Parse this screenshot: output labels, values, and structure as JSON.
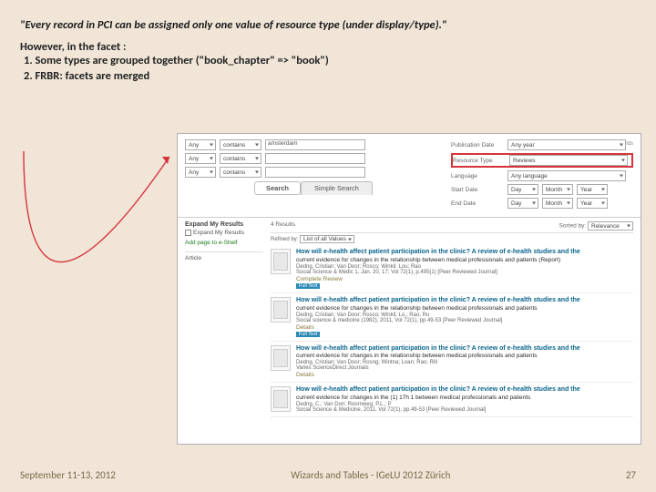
{
  "slide": {
    "quote": "\"Every record in PCI can be assigned only one value of resource type (under display/type).\"",
    "however": "However, in the facet :",
    "list": [
      "1.   Some types are grouped together (\"book_chapter\" => \"book\")",
      "2.   FRBR: facets are merged"
    ]
  },
  "screenshot": {
    "terms": [
      {
        "field": "Any",
        "op": "contains",
        "value": "amsterdam"
      },
      {
        "field": "Any",
        "op": "contains",
        "value": ""
      },
      {
        "field": "Any",
        "op": "contains",
        "value": ""
      }
    ],
    "filters": {
      "pubdate_label": "Publication Date",
      "pubdate_value": "Any year",
      "restype_label": "Resource Type",
      "restype_value": "Reviews",
      "lang_label": "Language",
      "lang_value": "Any language",
      "start_label": "Start Date",
      "end_label": "End Date",
      "day": "Day",
      "month": "Month",
      "year": "Year"
    },
    "reset": "reset all fields",
    "search_btn": "Search",
    "simple_tab": "Simple Search",
    "facet_header": "Expand My Results",
    "facet_cb": "Expand My Results",
    "add_page": "Add page to e-Shelf",
    "facet_article": "Article",
    "results_count": "4 Results",
    "refined_by": "Refined by:",
    "sorted_by": "Sorted by:",
    "sort_value": "Relevance",
    "list_of": "List of all Values",
    "items": [
      {
        "title": "How will e-health affect patient participation in the clinic? A review of e-health studies and the",
        "sub": "current evidence for changes in the relationship between medical professionals and patients (Report)",
        "authors": "Dedng, Cristian; Van Door; Rosco; Winkli; Lou; Rao",
        "src": "Social Science & Medic 1, Jan. 20, 17; Vol 72(1), p.495(1) [Peer Reviewed Journal]",
        "cat": "Complete Review",
        "badge": "Full Text"
      },
      {
        "title": "How will e-health affect patient participation in the clinic? A review of e-health studies and the",
        "sub": "current evidence for changes in the relationship between medical professionals and patients",
        "authors": "Dedng, Cristian; Van Door; Rosco; Winkli; Lo.; Rao; Ru",
        "src": "Social science & medicine (1982), 2011, Vol 72(1), pp.49-53 [Peer Reviewed Journal]",
        "cat": "Details",
        "badge": "Full Text"
      },
      {
        "title": "How will e-health affect patient participation in the clinic? A review of e-health studies and the",
        "sub": "current evidence for changes in the relationship between medical professionals and patients",
        "authors": "Dedng, Cristian; Van Door; Rosng; Wintna; Loan; Rao; Rill",
        "src": "Varies ScienceDirect Journals",
        "cat": "Details",
        "badge": ""
      },
      {
        "title": "How will e-health affect patient participation in the clinic? A review of e-health studies and the",
        "sub": "current evidence for changes in the (1) 17h 1 between medical professionals and patients",
        "authors": "Dedng, C.; Van Don; Roornweg; P.L.; P",
        "src": "Social Science & Medicine, 2011, Vol 72(1), pp.49-53 [Peer Reviewed Journal]",
        "cat": "",
        "badge": ""
      }
    ]
  },
  "footer": {
    "left": "September 11-13, 2012",
    "center": "Wizards and Tables - IGeLU 2012 Zürich",
    "right": "27"
  },
  "colors": {
    "highlight": "#d6343a"
  }
}
